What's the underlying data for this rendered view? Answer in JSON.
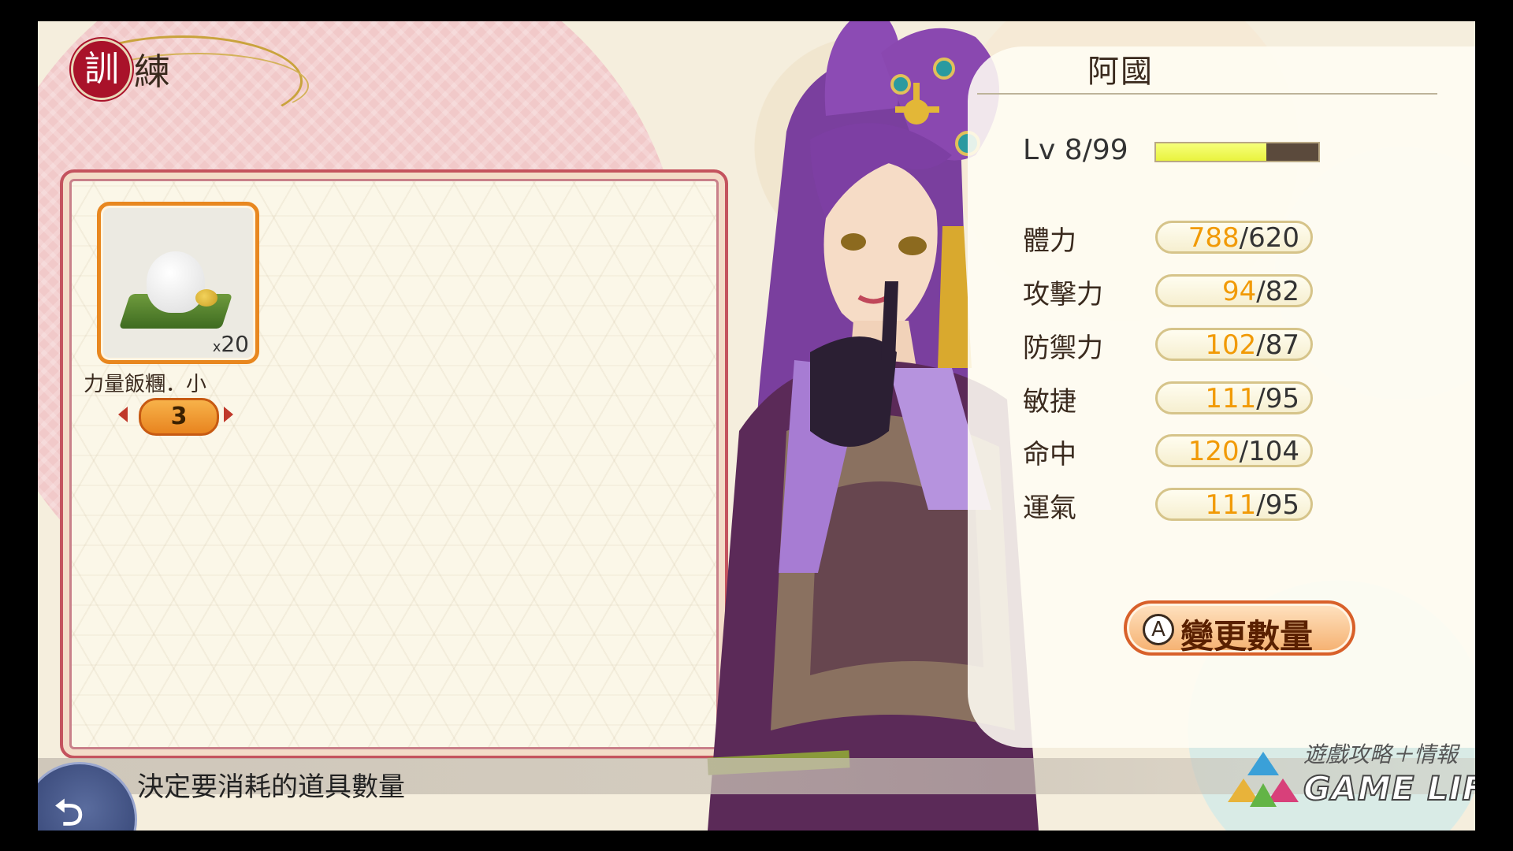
{
  "title": {
    "seal_char": "訓",
    "second_char": "練"
  },
  "inventory": {
    "item": {
      "name": "力量飯糰．小",
      "count_prefix": "x",
      "count": "20",
      "quantity": "3"
    }
  },
  "character": {
    "name": "阿國",
    "level": {
      "label": "Lv 8/99",
      "progress": 0.68
    },
    "stats": [
      {
        "label": "體力",
        "current": "788",
        "base": "/620"
      },
      {
        "label": "攻擊力",
        "current": "94",
        "base": "/82"
      },
      {
        "label": "防禦力",
        "current": "102",
        "base": "/87"
      },
      {
        "label": "敏捷",
        "current": "111",
        "base": "/95"
      },
      {
        "label": "命中",
        "current": "120",
        "base": "/104"
      },
      {
        "label": "運氣",
        "current": "111",
        "base": "/95"
      }
    ]
  },
  "actions": {
    "change_quantity_key": "A",
    "change_quantity_label": "變更數量"
  },
  "hint": {
    "text": "決定要消耗的道具數量"
  },
  "watermark": {
    "tagline": "遊戲攻略＋情報",
    "logo": "GAME LIFE"
  },
  "colors": {
    "accent_orange": "#e8841f",
    "stat_current": "#f19a06",
    "panel_border": "#c4535e",
    "seal_red": "#a9122a",
    "level_fill": "#e9f33e"
  }
}
